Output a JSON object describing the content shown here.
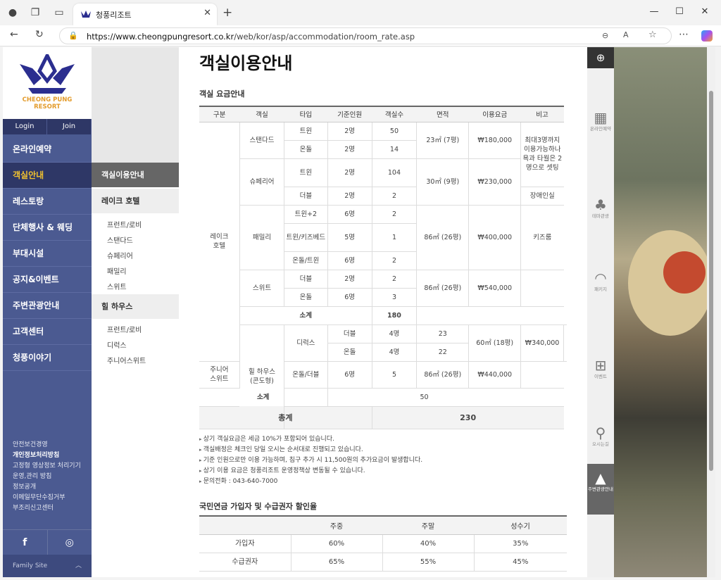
{
  "browser": {
    "tab_title": "청풍리조트",
    "url_host": "https://www.cheongpungresort.co.kr",
    "url_path": "/web/kor/asp/accommodation/room_rate.asp"
  },
  "logo": {
    "name": "CHEONG PUNG",
    "sub": "RESORT",
    "color": "#2b2e8f"
  },
  "auth": {
    "login": "Login",
    "join": "Join"
  },
  "main_menu": [
    "온라인예약",
    "객실안내",
    "레스토랑",
    "단체행사 & 웨딩",
    "부대시설",
    "공지&이벤트",
    "주변관광안내",
    "고객센터",
    "청풍이야기"
  ],
  "footer_links": [
    "안전보건경영",
    "개인정보처리방침",
    "고정형 영상정보 처리기기",
    "운영,관리 방침",
    "정보공개",
    "이메일무단수집거부",
    "부조리신고센터"
  ],
  "social": {
    "facebook": "f",
    "instagram": "◎"
  },
  "family_site": "Family Site",
  "sub_menu": {
    "current": "객실이용안내",
    "group1": "레이크 호텔",
    "group1_items": [
      "프런트/로비",
      "스탠다드",
      "슈페리어",
      "패밀리",
      "스위트"
    ],
    "group2": "힐 하우스",
    "group2_items": [
      "프런트/로비",
      "디럭스",
      "주니어스위트"
    ]
  },
  "content": {
    "title": "객실이용안내",
    "rate_section": "객실 요금안내",
    "rate_headers": [
      "구분",
      "객실",
      "타입",
      "기준인원",
      "객실수",
      "면적",
      "이용요금",
      "비고"
    ],
    "lake": "레이크\n호텔",
    "hill": "힐 하우스\n(콘도형)",
    "standard": {
      "name": "스탠다드",
      "t1": "트윈",
      "p1": "2명",
      "c1": "50",
      "t2": "온돌",
      "p2": "2명",
      "c2": "14",
      "area": "23㎡ (7평)",
      "price": "₩180,000",
      "note": "최대3명까지 이용가능하나 욕과 타월은 2명으로 셋팅"
    },
    "superior": {
      "name": "슈페리어",
      "t1": "트윈",
      "p1": "2명",
      "c1": "104",
      "t2": "더블",
      "p2": "2명",
      "c2": "2",
      "area": "30㎡ (9평)",
      "price": "₩230,000",
      "note": "장애인실"
    },
    "family": {
      "name": "패밀리",
      "t1": "트윈+2",
      "p1": "6명",
      "c1": "2",
      "t2": "트윈/키즈베드",
      "p2": "5명",
      "c2": "1",
      "t3": "온돌/트윈",
      "p3": "6명",
      "c3": "2",
      "area": "86㎡ (26평)",
      "price": "₩400,000",
      "note": "키즈룸"
    },
    "suite": {
      "name": "스위트",
      "t1": "더블",
      "p1": "2명",
      "c1": "2",
      "t2": "온돌",
      "p2": "6명",
      "c2": "3",
      "area": "86㎡ (26평)",
      "price": "₩540,000"
    },
    "lake_subtotal": {
      "label": "소계",
      "value": "180"
    },
    "deluxe": {
      "name": "디럭스",
      "t1": "더블",
      "p1": "4명",
      "c1": "23",
      "t2": "온돌",
      "p2": "4명",
      "c2": "22",
      "area": "60㎡ (18평)",
      "price": "₩340,000"
    },
    "junior": {
      "name": "주니어\n스위트",
      "t1": "온돌/더블",
      "p1": "6명",
      "c1": "5",
      "area": "86㎡ (26평)",
      "price": "₩440,000"
    },
    "hill_subtotal": {
      "label": "소계",
      "value": "50"
    },
    "total": {
      "label": "총계",
      "value": "230"
    },
    "notes": [
      "상기 객실요금은 세금 10%가 포함되어 있습니다.",
      "객실배정은 체크인 당일 오시는 순서대로 진행되고 있습니다.",
      "기준 인원으로만 이용 가능하며, 침구 추가 시 11,500원의 추가요금이 발생합니다.",
      "상기 이용 요금은 청풍리조트 운영정책상 변동될 수 있습니다.",
      "문의전화 : 043-640-7000"
    ],
    "discount_section": "국민연금 가입자 및 수급권자 할인율",
    "discount_headers": [
      "",
      "주중",
      "주말",
      "성수기"
    ],
    "discount_rows": [
      [
        "가입자",
        "60%",
        "40%",
        "35%"
      ],
      [
        "수급권자",
        "65%",
        "55%",
        "45%"
      ]
    ]
  },
  "quick_menu": {
    "online": "온라인예약",
    "theme": "테마관광",
    "package": "패키지",
    "event": "이벤트",
    "map": "오시는길",
    "tour": "주변관광안내"
  }
}
